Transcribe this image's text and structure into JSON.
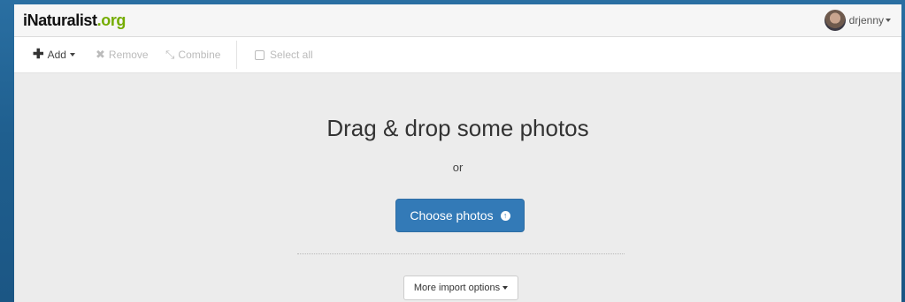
{
  "brand": {
    "name": "iNaturalist",
    "domain": ".org",
    "name_color": "#111111",
    "domain_color": "#74ac00"
  },
  "user": {
    "username": "drjenny",
    "avatar_icon": "user-avatar"
  },
  "toolbar": {
    "add_label": "Add",
    "remove_label": "Remove",
    "combine_label": "Combine",
    "select_all_label": "Select all",
    "icons": {
      "add": "plus-icon",
      "remove": "x-icon",
      "combine": "compress-icon",
      "select_all": "checkbox-icon"
    }
  },
  "dropzone": {
    "title": "Drag & drop some photos",
    "or_text": "or",
    "choose_button": "Choose photos",
    "choose_button_color": "#337ab7",
    "more_import_options": "More import options"
  }
}
